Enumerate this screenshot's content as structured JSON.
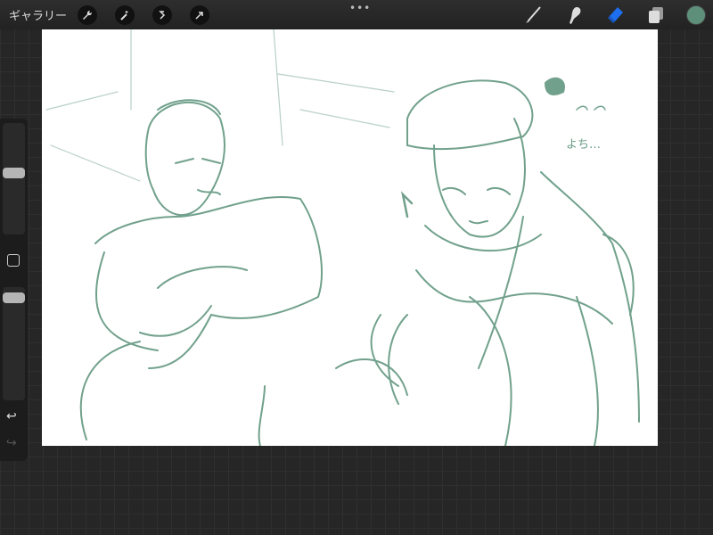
{
  "topbar": {
    "gallery_label": "ギャラリー",
    "tools_left": [
      "wrench-icon",
      "magic-wand-icon",
      "selection-icon",
      "transform-arrow-icon"
    ],
    "more_label": "•••",
    "tools_right": [
      "brush-icon",
      "smudge-icon",
      "eraser-icon",
      "layers-icon"
    ],
    "active_tool": "eraser",
    "current_color": "#5e8f7a",
    "accent_color": "#1e6ff0"
  },
  "sidebar": {
    "brush_size": 0.56,
    "opacity": 0.95,
    "undo_icon": "undo-icon",
    "redo_icon": "redo-icon",
    "modify_icon": "square-icon"
  },
  "canvas": {
    "stroke_color": "#4e8a70",
    "handwriting": "よち…"
  }
}
